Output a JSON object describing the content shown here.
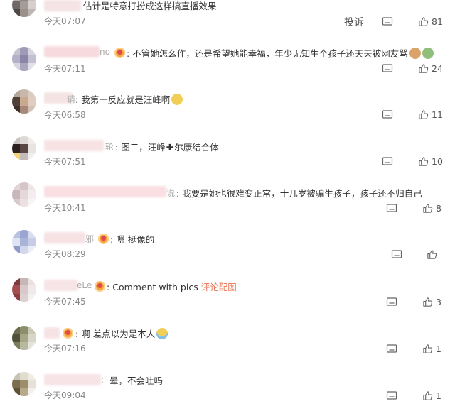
{
  "report_label": "投诉",
  "comments": [
    {
      "text": "估计是特意打扮成这样搞直播效果",
      "time": "今天07:07",
      "likes": "81"
    },
    {
      "name_tail": "no",
      "text": "不管她怎么作，还是希望她能幸福，年少无知生个孩子还天天被网友骂",
      "time": "今天07:11",
      "likes": "24"
    },
    {
      "name_tail": "请",
      "text": "我第一反应就是汪峰啊",
      "time": "今天06:58",
      "likes": "11"
    },
    {
      "name_tail": "轮",
      "text": "图二，汪峰",
      "text_after": "尔康结合体",
      "time": "今天07:51",
      "likes": "10"
    },
    {
      "name_tail": "说",
      "text": "我要是她也很难变正常，十几岁被骗生孩子，孩子还不归自己",
      "time": "今天10:41",
      "likes": "8"
    },
    {
      "name_tail": "邪",
      "text": "嗯 挺像的",
      "time": "今天08:29",
      "likes": ""
    },
    {
      "name_tail": "eLe",
      "text": "Comment with pics",
      "link": "评论配图",
      "time": "今天07:45",
      "likes": "3"
    },
    {
      "name_tail": "",
      "text": "啊 差点以为是本人",
      "time": "今天07:16",
      "likes": "1"
    },
    {
      "name_tail": ":",
      "text": "晕，不会吐吗",
      "time": "今天09:04",
      "likes": "1"
    }
  ]
}
